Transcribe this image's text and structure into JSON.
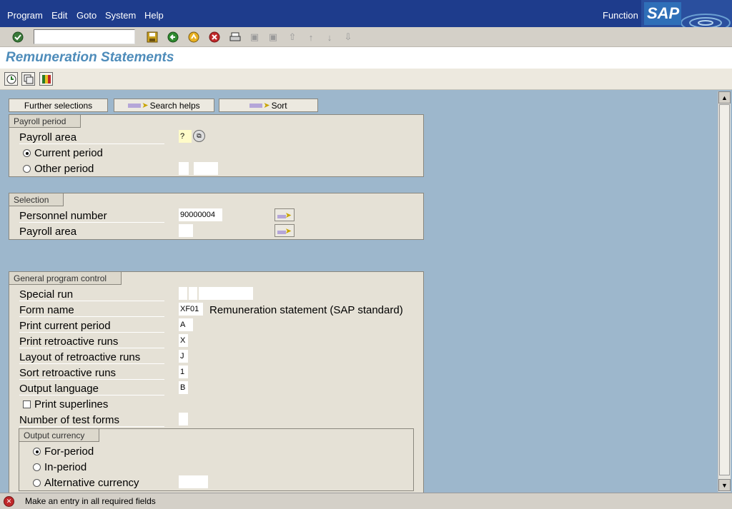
{
  "menubar": {
    "items": [
      "Program",
      "Edit",
      "Goto",
      "System",
      "Help"
    ],
    "function_label": "Function",
    "logo_text": "SAP"
  },
  "toolbar": {
    "command_field_value": ""
  },
  "title": "Remuneration Statements",
  "buttons": {
    "further_selections": "Further selections",
    "search_helps": "Search helps",
    "sort": "Sort"
  },
  "payroll_period": {
    "title": "Payroll period",
    "payroll_area_label": "Payroll area",
    "payroll_area_value": "?",
    "current_period_label": "Current period",
    "other_period_label": "Other period"
  },
  "selection": {
    "title": "Selection",
    "personnel_number_label": "Personnel number",
    "personnel_number_value": "90000004",
    "payroll_area_label": "Payroll area",
    "payroll_area_value": ""
  },
  "general": {
    "title": "General program control",
    "special_run_label": "Special run",
    "form_name_label": "Form name",
    "form_name_value": "XF01",
    "form_name_desc": "Remuneration statement (SAP standard)",
    "print_current_period_label": "Print current period",
    "print_current_period_value": "A",
    "print_retroactive_runs_label": "Print retroactive runs",
    "print_retroactive_runs_value": "X",
    "layout_retroactive_runs_label": "Layout of retroactive runs",
    "layout_retroactive_runs_value": "J",
    "sort_retroactive_runs_label": "Sort retroactive runs",
    "sort_retroactive_runs_value": "1",
    "output_language_label": "Output language",
    "output_language_value": "B",
    "print_superlines_label": "Print superlines",
    "number_test_forms_label": "Number of test forms",
    "number_test_forms_value": ""
  },
  "output_currency": {
    "title": "Output currency",
    "for_period_label": "For-period",
    "in_period_label": "In-period",
    "alternative_currency_label": "Alternative currency"
  },
  "status": {
    "message": "Make an entry in all required fields"
  },
  "colors": {
    "menubar": "#1e3c8c",
    "title": "#4e8cba",
    "background": "#9db7cc",
    "group": "#e5e1d6"
  }
}
